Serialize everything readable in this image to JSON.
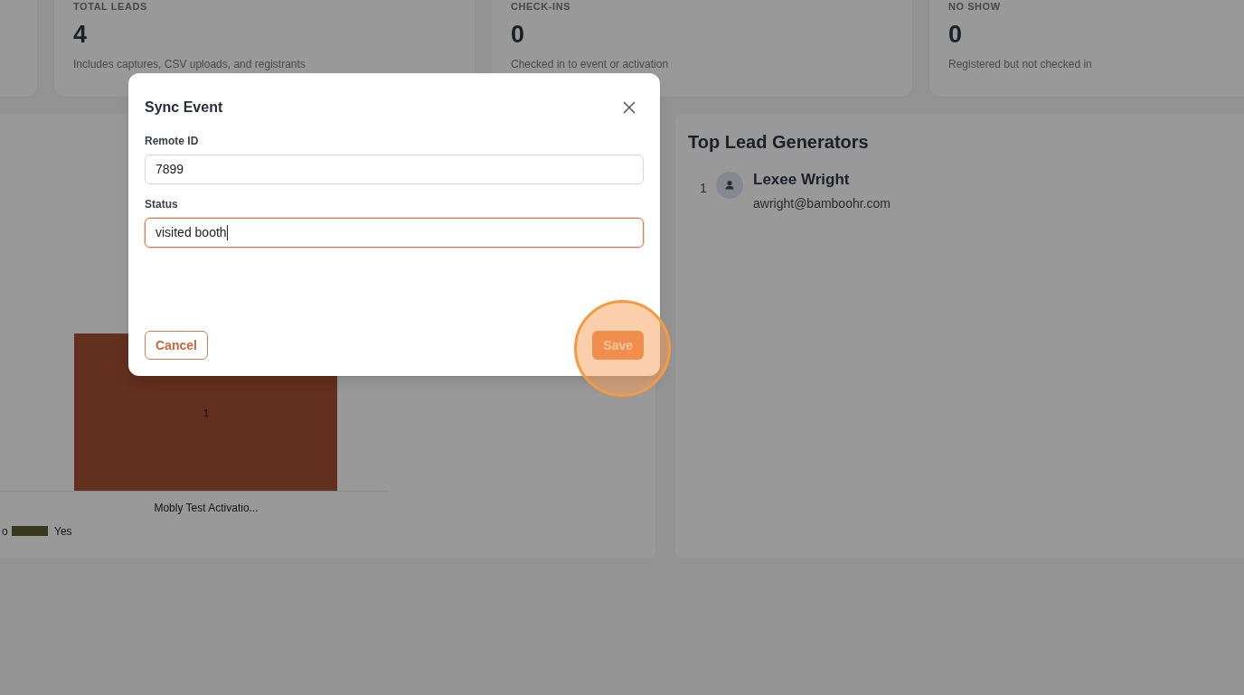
{
  "stats": [
    {
      "label": "TOTAL LEADS",
      "value": "4",
      "note": "Includes captures, CSV uploads, and registrants"
    },
    {
      "label": "CHECK-INS",
      "value": "0",
      "note": "Checked in to event or activation"
    },
    {
      "label": "NO SHOW",
      "value": "0",
      "note": "Registered but not checked in"
    }
  ],
  "chart_panel": {
    "bar_label": "1",
    "category": "Mobly Test Activatio...",
    "legend": [
      {
        "label": "o"
      },
      {
        "label": "Yes",
        "color": "#38381f"
      }
    ]
  },
  "top_lead_generators": {
    "title": "Top Lead Generators",
    "items": [
      {
        "rank": "1",
        "name": "Lexee Wright",
        "email": "awright@bamboohr.com"
      }
    ]
  },
  "dialog": {
    "title": "Sync Event",
    "fields": [
      {
        "label": "Remote ID",
        "value": "7899",
        "focused": false
      },
      {
        "label": "Status",
        "value": "visited booth",
        "focused": true
      }
    ],
    "cancel": "Cancel",
    "save": "Save",
    "save_highlighted": true
  }
}
